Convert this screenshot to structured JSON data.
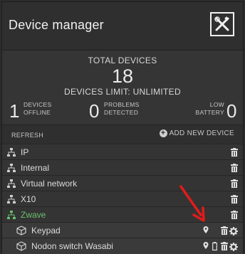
{
  "header": {
    "title": "Device manager",
    "logo_icon": "tools-cross-icon"
  },
  "totals": {
    "label": "TOTAL DEVICES",
    "count": "18",
    "limit": "DEVICES LIMIT: UNLIMITED",
    "stats": [
      {
        "value": "1",
        "label_line1": "DEVICES",
        "label_line2": "OFFLINE"
      },
      {
        "value": "0",
        "label_line1": "PROBLEMS",
        "label_line2": "DETECTED"
      },
      {
        "value": "0",
        "label_line1": "LOW",
        "label_line2": "BATTERY"
      }
    ]
  },
  "toolbar": {
    "refresh": "REFRESH",
    "add_device": "ADD NEW DEVICE"
  },
  "networks": [
    {
      "label": "IP"
    },
    {
      "label": "Internal"
    },
    {
      "label": "Virtual network"
    },
    {
      "label": "X10"
    },
    {
      "label": "Zwave",
      "color": "#6bc16b"
    }
  ],
  "devices": [
    {
      "label": "Keypad"
    },
    {
      "label": "Nodon switch Wasabi"
    }
  ],
  "colors": {
    "background": "#303030",
    "accent_green": "#6bc16b",
    "annotation_arrow": "#e11b1b"
  }
}
